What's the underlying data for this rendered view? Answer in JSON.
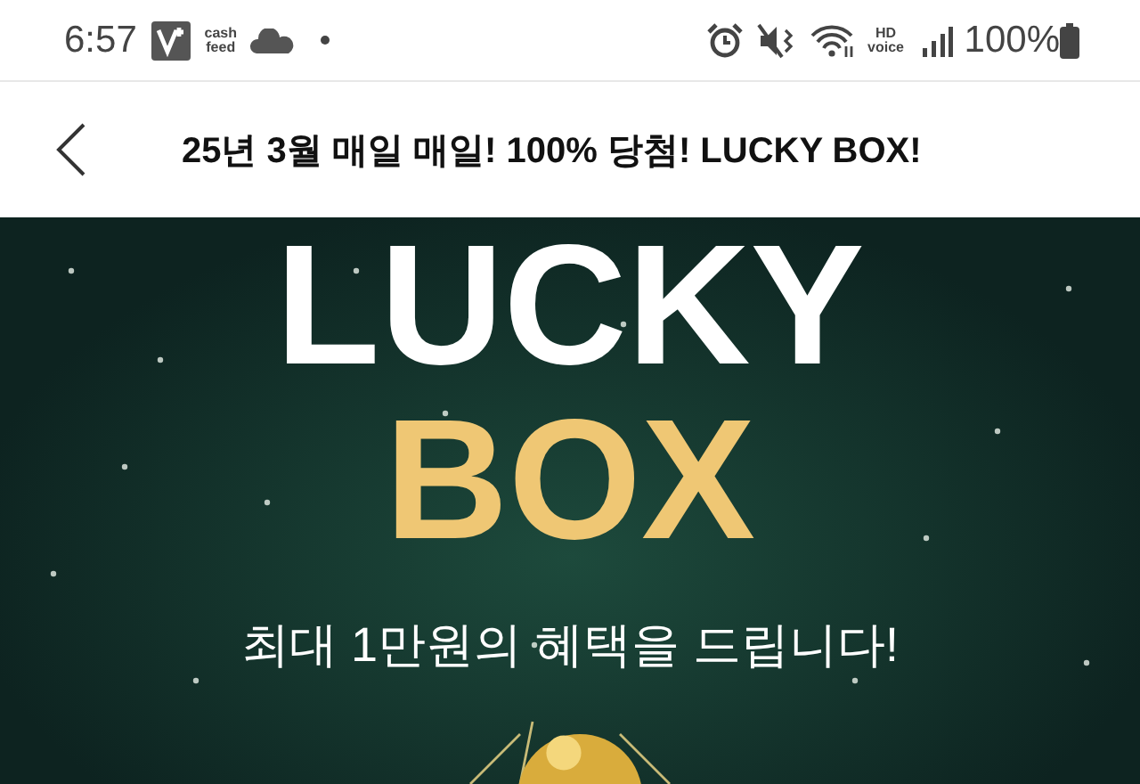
{
  "status_bar": {
    "time": "6:57",
    "app_label": "cash feed",
    "network_label": "HD voice",
    "battery": "100%"
  },
  "header": {
    "title": "25년 3월 매일 매일! 100% 당첨! LUCKY BOX!"
  },
  "banner": {
    "headline": "LUCKY",
    "subheadline": "BOX",
    "caption": "최대 1만원의 혜택을 드립니다!"
  }
}
